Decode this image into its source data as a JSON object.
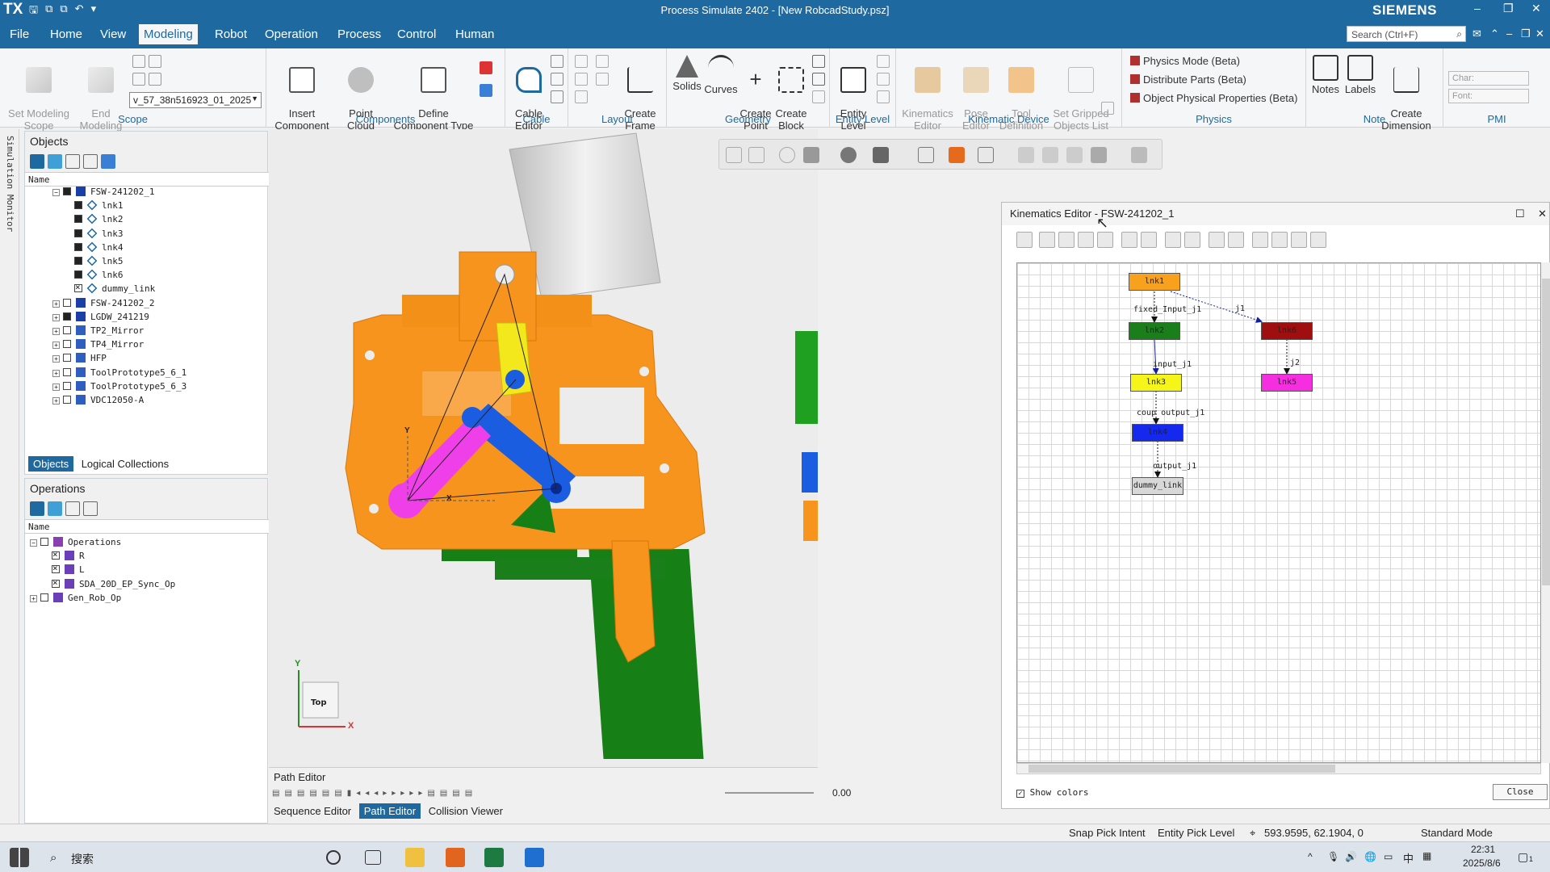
{
  "titlebar": {
    "logo": "TX",
    "title": "Process Simulate 2402 - [New RobcadStudy.psz]",
    "brand": "SIEMENS"
  },
  "menu": [
    "File",
    "Home",
    "View",
    "Modeling",
    "Robot",
    "Operation",
    "Process",
    "Control",
    "Human"
  ],
  "menu_active": "Modeling",
  "search": {
    "placeholder": "Search (Ctrl+F)"
  },
  "ribbon": {
    "scope": {
      "set_modeling_scope": "Set Modeling\nScope",
      "end_modeling": "End\nModeling",
      "scope_value": "v_57_38n516923_01_2025",
      "group": "Scope"
    },
    "components": {
      "insert_component": "Insert\nComponent",
      "point_cloud": "Point\nCloud",
      "define_component_type": "Define\nComponent Type",
      "group": "Components"
    },
    "cable": {
      "cable_editor": "Cable\nEditor",
      "group": "Cable"
    },
    "layout": {
      "create_frame": "Create\nFrame",
      "group": "Layout"
    },
    "geometry": {
      "solids": "Solids",
      "curves": "Curves",
      "create_point": "Create\nPoint",
      "create_block": "Create\nBlock",
      "group": "Geometry"
    },
    "entity_level": {
      "entity_level": "Entity\nLevel",
      "group": "Entity Level"
    },
    "kinematic_device": {
      "kinematics_editor": "Kinematics\nEditor",
      "pose_editor": "Pose\nEditor",
      "tool_definition": "Tool\nDefinition",
      "set_gripped_objects_list": "Set Gripped\nObjects List",
      "group": "Kinematic Device"
    },
    "physics": {
      "items": [
        "Physics Mode (Beta)",
        "Distribute Parts (Beta)",
        "Object Physical Properties (Beta)"
      ],
      "group": "Physics"
    },
    "note": {
      "notes": "Notes",
      "labels": "Labels",
      "create_dimension": "Create\nDimension",
      "group": "Note"
    },
    "pmi": {
      "char": "Char:",
      "font": "Font:",
      "group": "PMI"
    }
  },
  "sim_monitor": "Simulation Monitor",
  "objects_panel": {
    "title": "Objects",
    "column": "Name",
    "rows": [
      {
        "label": "FSW-241202_1",
        "exp": "−",
        "level": 3,
        "chk": "full",
        "icon": "robot"
      },
      {
        "label": "lnk1",
        "level": 4,
        "chk": "full",
        "icon": "link"
      },
      {
        "label": "lnk2",
        "level": 4,
        "chk": "full",
        "icon": "link"
      },
      {
        "label": "lnk3",
        "level": 4,
        "chk": "full",
        "icon": "link"
      },
      {
        "label": "lnk4",
        "level": 4,
        "chk": "full",
        "icon": "link"
      },
      {
        "label": "lnk5",
        "level": 4,
        "chk": "full",
        "icon": "link"
      },
      {
        "label": "lnk6",
        "level": 4,
        "chk": "full",
        "icon": "link"
      },
      {
        "label": "dummy_link",
        "level": 4,
        "chk": "x",
        "icon": "link"
      },
      {
        "label": "FSW-241202_2",
        "exp": "+",
        "level": 3,
        "chk": "empty",
        "icon": "robot"
      },
      {
        "label": "LGDW_241219",
        "exp": "+",
        "level": 3,
        "chk": "full",
        "icon": "robot"
      },
      {
        "label": "TP2_Mirror",
        "exp": "+",
        "level": 3,
        "chk": "empty",
        "icon": "part"
      },
      {
        "label": "TP4_Mirror",
        "exp": "+",
        "level": 3,
        "chk": "empty",
        "icon": "part"
      },
      {
        "label": "HFP",
        "exp": "+",
        "level": 3,
        "chk": "empty",
        "icon": "part"
      },
      {
        "label": "ToolPrototype5_6_1",
        "exp": "+",
        "level": 3,
        "chk": "empty",
        "icon": "part"
      },
      {
        "label": "ToolPrototype5_6_3",
        "exp": "+",
        "level": 3,
        "chk": "empty",
        "icon": "part"
      },
      {
        "label": "VDC12050-A",
        "exp": "+",
        "level": 3,
        "chk": "empty",
        "icon": "part"
      }
    ],
    "tabs": [
      "Objects",
      "Logical Collections"
    ]
  },
  "operations_panel": {
    "title": "Operations",
    "column": "Name",
    "rows": [
      {
        "label": "Operations",
        "exp": "−",
        "level": 1,
        "chk": "empty",
        "icon": "ops"
      },
      {
        "label": "R",
        "level": 2,
        "chk": "x",
        "icon": "op"
      },
      {
        "label": "L",
        "level": 2,
        "chk": "x",
        "icon": "op"
      },
      {
        "label": "SDA_20D_EP_Sync_Op",
        "level": 2,
        "chk": "x",
        "icon": "op"
      },
      {
        "label": "Gen_Rob_Op",
        "exp": "+",
        "level": 1,
        "chk": "empty",
        "icon": "op"
      }
    ]
  },
  "viewport": {
    "view_cube": "Top",
    "axis_y": "Y",
    "axis_x": "X",
    "frame_y": "Y",
    "frame_x": "X"
  },
  "path_editor": {
    "title": "Path Editor",
    "time": "0.00",
    "tabs": [
      "Sequence Editor",
      "Path Editor",
      "Collision Viewer"
    ],
    "active_tab": "Path Editor"
  },
  "kinematics_editor": {
    "title": "Kinematics Editor - FSW-241202_1",
    "nodes": [
      {
        "id": "lnk1",
        "label": "lnk1",
        "color": "#f7a11c"
      },
      {
        "id": "lnk2",
        "label": "lnk2",
        "color": "#1a7f1a"
      },
      {
        "id": "lnk3",
        "label": "lnk3",
        "color": "#f5f51a"
      },
      {
        "id": "lnk4",
        "label": "lnk4",
        "color": "#1428ee"
      },
      {
        "id": "lnk5",
        "label": "lnk5",
        "color": "#f52ee0"
      },
      {
        "id": "lnk6",
        "label": "lnk6",
        "color": "#a00f0f"
      },
      {
        "id": "dummy_link",
        "label": "dummy_link",
        "color": "#d8d8d8"
      }
    ],
    "edges": [
      {
        "label": "fixed_Input_j1"
      },
      {
        "label": "j1"
      },
      {
        "label": "input_j1"
      },
      {
        "label": "j2"
      },
      {
        "label": "coup output_j1"
      },
      {
        "label": "output_j1"
      }
    ],
    "show_colors": "Show colors",
    "close": "Close"
  },
  "statusbar": {
    "snap": "Snap Pick Intent",
    "entity": "Entity Pick Level",
    "coords": "593.9595, 62.1904, 0",
    "mode": "Standard Mode"
  },
  "taskbar": {
    "search": "搜索",
    "time": "22:31",
    "date": "2025/8/6",
    "ime": "中",
    "notif": "1"
  },
  "colors": {
    "brand_blue": "#1e6aa0",
    "orange_part": "#f7941d",
    "green_part": "#168016",
    "magenta_arm": "#ef3fe8",
    "blue_arm": "#1a5de0",
    "yellow_arm": "#f2e81b"
  }
}
